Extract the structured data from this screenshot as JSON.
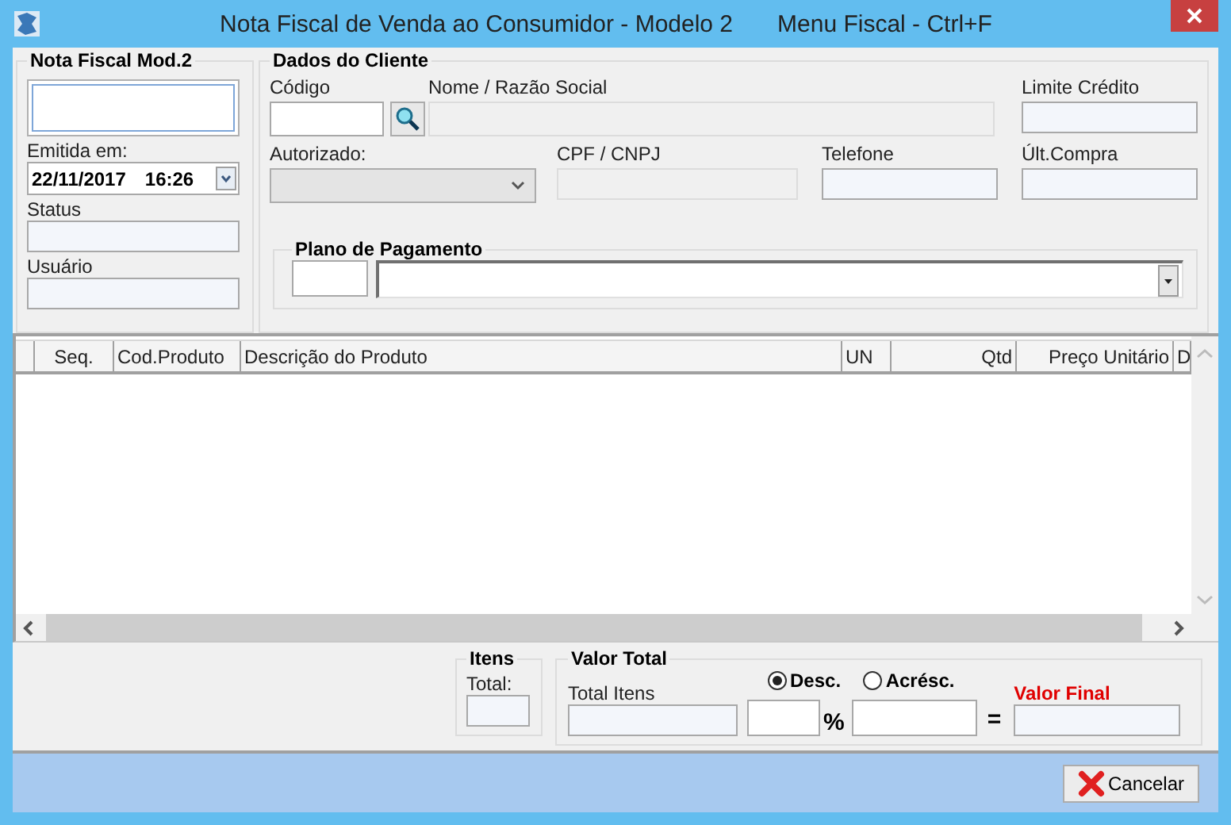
{
  "window": {
    "title": "Nota Fiscal de Venda ao Consumidor - Modelo 2",
    "shortcut": "Menu Fiscal - Ctrl+F"
  },
  "nota": {
    "title": "Nota Fiscal Mod.2",
    "emitida_label": "Emitida em:",
    "date": "22/11/2017",
    "time": "16:26",
    "status_label": "Status",
    "usuario_label": "Usuário"
  },
  "cliente": {
    "title": "Dados do Cliente",
    "codigo_label": "Código",
    "nome_label": "Nome / Razão Social",
    "limite_label": "Limite Crédito",
    "autorizado_label": "Autorizado:",
    "cpf_label": "CPF / CNPJ",
    "telefone_label": "Telefone",
    "ult_compra_label": "Últ.Compra"
  },
  "plano": {
    "title": "Plano de Pagamento"
  },
  "table": {
    "columns": [
      "Seq.",
      "Cod.Produto",
      "Descrição do Produto",
      "UN",
      "Qtd",
      "Preço Unitário",
      "D"
    ]
  },
  "itens": {
    "title": "Itens",
    "total_label": "Total:"
  },
  "valor_total": {
    "title": "Valor Total",
    "total_itens_label": "Total Itens",
    "options": [
      {
        "label": "Desc.",
        "selected": true
      },
      {
        "label": "Acrésc.",
        "selected": false
      }
    ],
    "percent": "%",
    "equals": "=",
    "valor_final_label": "Valor Final"
  },
  "buttons": [
    {
      "label": "Cancelar"
    }
  ]
}
